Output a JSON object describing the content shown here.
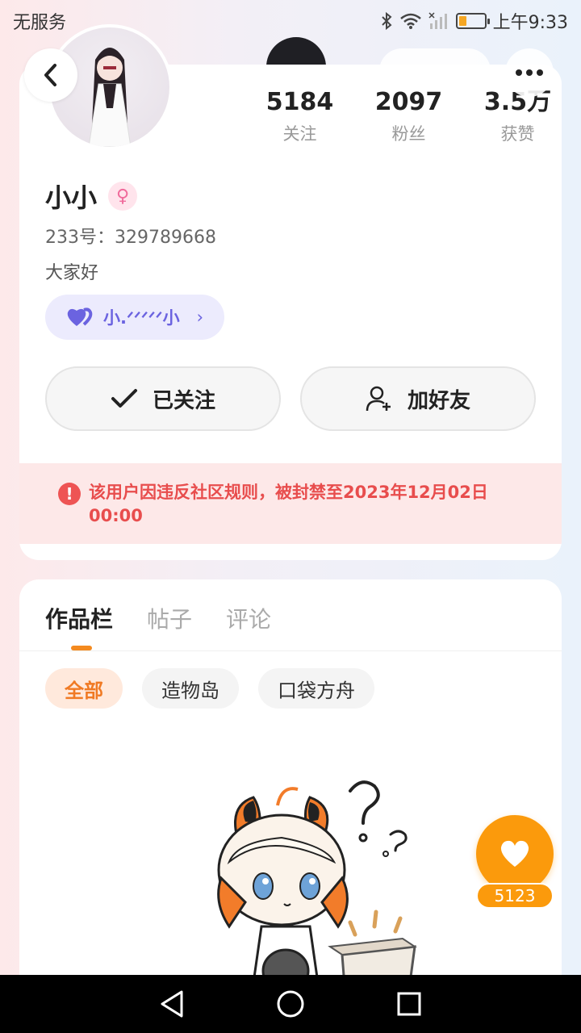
{
  "status_bar": {
    "carrier": "无服务",
    "time": "上午9:33"
  },
  "profile": {
    "name": "小小",
    "id_line": "233号：329789668",
    "bio": "大家好",
    "tag_label": "小.ᐟᐟᐟᐟᐟ小",
    "stats": [
      {
        "value": "5184",
        "label": "关注"
      },
      {
        "value": "2097",
        "label": "粉丝"
      },
      {
        "value": "3.5万",
        "label": "获赞"
      }
    ],
    "follow_button": "已关注",
    "add_friend_button": "加好友",
    "ban_notice": "该用户因违反社区规则，被封禁至2023年12月02日 00:00"
  },
  "works": {
    "tabs": [
      "作品栏",
      "帖子",
      "评论"
    ],
    "filters": [
      "全部",
      "造物岛",
      "口袋方舟"
    ]
  },
  "like_float": {
    "count": "5123"
  },
  "colors": {
    "accent_orange": "#fb9a0c",
    "ban_red": "#e84d4d",
    "tag_purple": "#6b63e0"
  }
}
